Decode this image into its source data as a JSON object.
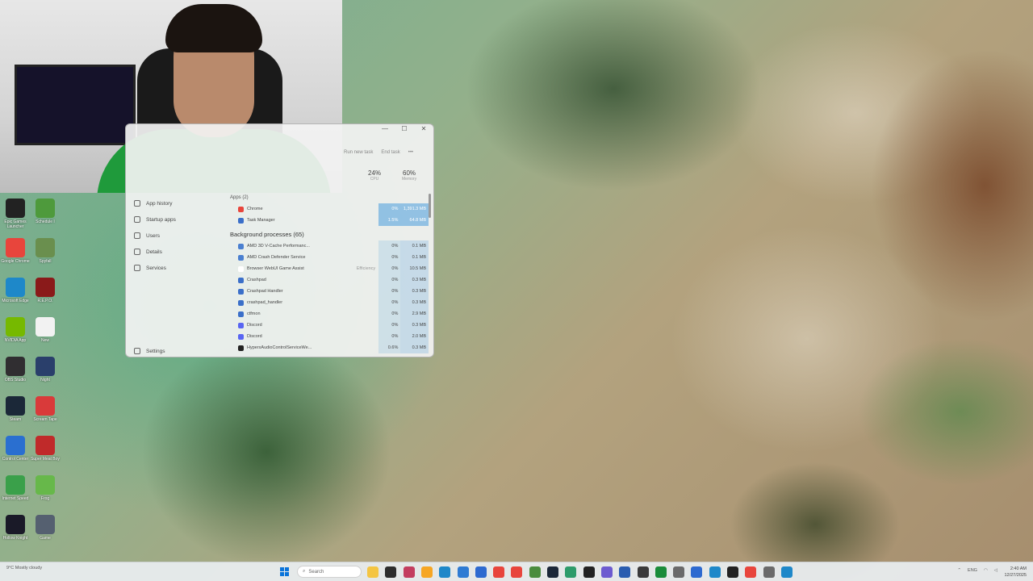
{
  "taskmgr": {
    "titlebar": {
      "minimize": "—",
      "maximize": "☐",
      "close": "✕"
    },
    "toolbar": {
      "run_new_task": "Run new task",
      "end_task": "End task",
      "more": "•••"
    },
    "stats": {
      "cpu_pct": "24%",
      "cpu_label": "CPU",
      "mem_pct": "60%",
      "mem_label": "Memory"
    },
    "nav": [
      {
        "label": "App history"
      },
      {
        "label": "Startup apps"
      },
      {
        "label": "Users"
      },
      {
        "label": "Details"
      },
      {
        "label": "Services"
      }
    ],
    "settings_label": "Settings",
    "apps_header": "Apps (2)",
    "apps": [
      {
        "name": "Chrome",
        "status": "",
        "cpu": "0%",
        "mem": "1,391.3 MB",
        "color": "#e8453c"
      },
      {
        "name": "Task Manager",
        "status": "",
        "cpu": "1.5%",
        "mem": "64.8 MB",
        "color": "#3b6fc9"
      }
    ],
    "bg_header": "Background processes (65)",
    "background": [
      {
        "name": "AMD 3D V-Cache Performanc...",
        "status": "",
        "cpu": "0%",
        "mem": "0.1 MB",
        "color": "#4a7fd0"
      },
      {
        "name": "AMD Crash Defender Service",
        "status": "",
        "cpu": "0%",
        "mem": "0.1 MB",
        "color": "#4a7fd0"
      },
      {
        "name": "Browser WebUI Game Assist",
        "status": "Efficiency",
        "cpu": "0%",
        "mem": "10.5 MB",
        "color": "#ffffff"
      },
      {
        "name": "Crashpad",
        "status": "",
        "cpu": "0%",
        "mem": "0.3 MB",
        "color": "#3b6fc9"
      },
      {
        "name": "Crashpad Handler",
        "status": "",
        "cpu": "0%",
        "mem": "0.3 MB",
        "color": "#3b6fc9"
      },
      {
        "name": "crashpad_handler",
        "status": "",
        "cpu": "0%",
        "mem": "0.3 MB",
        "color": "#3b6fc9"
      },
      {
        "name": "ctfmon",
        "status": "",
        "cpu": "0%",
        "mem": "2.9 MB",
        "color": "#3b6fc9"
      },
      {
        "name": "Discord",
        "status": "",
        "cpu": "0%",
        "mem": "0.3 MB",
        "color": "#5865f2"
      },
      {
        "name": "Discord",
        "status": "",
        "cpu": "0%",
        "mem": "2.0 MB",
        "color": "#5865f2"
      },
      {
        "name": "HyperxAudioControlServiceWe...",
        "status": "",
        "cpu": "0.6%",
        "mem": "0.3 MB",
        "color": "#222222"
      }
    ]
  },
  "desktop": {
    "icons": [
      {
        "label": "Epic Games Launcher",
        "color": "#222222"
      },
      {
        "label": "Schedule I",
        "color": "#4e9a3c"
      },
      {
        "label": "Google Chrome",
        "color": "#e8453c"
      },
      {
        "label": "Spyfall",
        "color": "#6a8f4e"
      },
      {
        "label": "Microsoft Edge",
        "color": "#1e88c9"
      },
      {
        "label": "R.E.P.O.",
        "color": "#8a1a1a"
      },
      {
        "label": "NVIDIA App",
        "color": "#76b900"
      },
      {
        "label": "New",
        "color": "#f2f2f2"
      },
      {
        "label": "OBS Studio",
        "color": "#302e31"
      },
      {
        "label": "Night",
        "color": "#2a3f6b"
      },
      {
        "label": "Steam",
        "color": "#1b2838"
      },
      {
        "label": "Scream Tape",
        "color": "#d93a3a"
      },
      {
        "label": "Control Center",
        "color": "#2a6fd0"
      },
      {
        "label": "Super Meat Boy",
        "color": "#c02a2a"
      },
      {
        "label": "Internet Speed",
        "color": "#3aa04a"
      },
      {
        "label": "Frog",
        "color": "#67b84a"
      },
      {
        "label": "Hollow Knight",
        "color": "#1a1a28"
      },
      {
        "label": "Game",
        "color": "#556070"
      }
    ]
  },
  "taskbar": {
    "weather": "9°C Mostly cloudy",
    "search_placeholder": "Search",
    "tray_lang": "ENG",
    "time": "2:40 AM",
    "date": "12/27/2025",
    "apps": [
      {
        "name": "file-explorer",
        "color": "#f4c542"
      },
      {
        "name": "files",
        "color": "#2d2d2d"
      },
      {
        "name": "app-1",
        "color": "#c33d5f"
      },
      {
        "name": "app-2",
        "color": "#f6a623"
      },
      {
        "name": "edge",
        "color": "#1e88c9"
      },
      {
        "name": "app-3",
        "color": "#2e7bd3"
      },
      {
        "name": "app-4",
        "color": "#2d6ad0"
      },
      {
        "name": "chrome",
        "color": "#e8453c"
      },
      {
        "name": "chrome-2",
        "color": "#e8453c"
      },
      {
        "name": "app-5",
        "color": "#4a8c3e"
      },
      {
        "name": "app-6",
        "color": "#1b2838"
      },
      {
        "name": "app-7",
        "color": "#2d9b6a"
      },
      {
        "name": "app-8",
        "color": "#222222"
      },
      {
        "name": "app-9",
        "color": "#6d5bd0"
      },
      {
        "name": "app-10",
        "color": "#2a5db0"
      },
      {
        "name": "app-11",
        "color": "#3a3a3a"
      },
      {
        "name": "app-12",
        "color": "#1a8c3a"
      },
      {
        "name": "app-13",
        "color": "#6a6a6a"
      },
      {
        "name": "app-14",
        "color": "#2d6ad0"
      },
      {
        "name": "app-15",
        "color": "#1e88c9"
      },
      {
        "name": "app-16",
        "color": "#222222"
      },
      {
        "name": "app-17",
        "color": "#e8453c"
      },
      {
        "name": "app-18",
        "color": "#6a6a6a"
      },
      {
        "name": "app-19",
        "color": "#1e88c9"
      }
    ]
  }
}
